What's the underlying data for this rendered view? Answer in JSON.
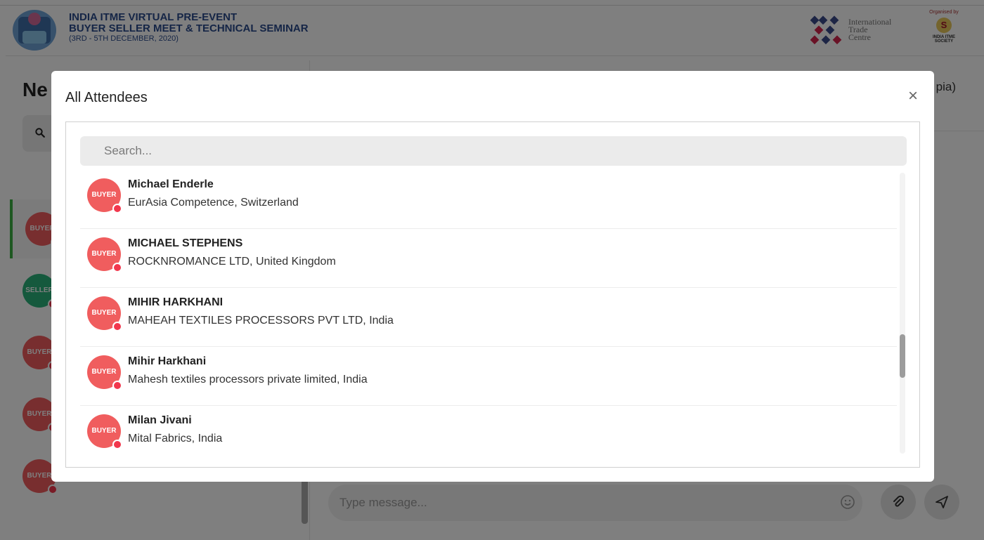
{
  "header": {
    "title_line1": "INDIA ITME VIRTUAL PRE-EVENT",
    "title_line2": "BUYER SELLER MEET & TECHNICAL SEMINAR",
    "title_line3": "(3RD - 5TH DECEMBER, 2020)",
    "partner_logo_lines": [
      "International",
      "Trade",
      "Centre"
    ],
    "organiser_label": "Organised by",
    "organiser_name": "INDIA ITME SOCIETY",
    "organiser_badge": "S"
  },
  "left_panel": {
    "heading": "Ne",
    "search_icon": "search-icon",
    "avatars": [
      {
        "label": "BUYER",
        "type": "buyer",
        "active": true
      },
      {
        "label": "SELLER",
        "type": "seller",
        "active": false
      },
      {
        "label": "BUYER",
        "type": "buyer",
        "active": false
      },
      {
        "label": "BUYER",
        "type": "buyer",
        "active": false
      },
      {
        "label": "BUYER",
        "type": "buyer",
        "active": false
      }
    ]
  },
  "right_panel": {
    "header_text": "pia)",
    "message_placeholder": "Type message...",
    "emoji_icon": "smile-icon",
    "attach_icon": "paperclip-icon",
    "send_icon": "send-icon"
  },
  "modal": {
    "title": "All Attendees",
    "close_label": "×",
    "search_placeholder": "Search...",
    "attendees": [
      {
        "badge": "BUYER",
        "name": "Michael Enderle",
        "org": "EurAsia Competence, Switzerland"
      },
      {
        "badge": "BUYER",
        "name": "MICHAEL STEPHENS",
        "org": "ROCKNROMANCE LTD, United Kingdom"
      },
      {
        "badge": "BUYER",
        "name": "MIHIR HARKHANI",
        "org": "MAHEAH TEXTILES PROCESSORS PVT LTD, India"
      },
      {
        "badge": "BUYER",
        "name": "Mihir Harkhani",
        "org": "Mahesh textiles processors private limited, India"
      },
      {
        "badge": "BUYER",
        "name": "Milan Jivani",
        "org": "Mital Fabrics, India"
      }
    ]
  },
  "colors": {
    "buyer": "#f05d5e",
    "seller": "#2ab27b",
    "status_dot": "#f2374d",
    "header_text": "#2a4b8d"
  }
}
